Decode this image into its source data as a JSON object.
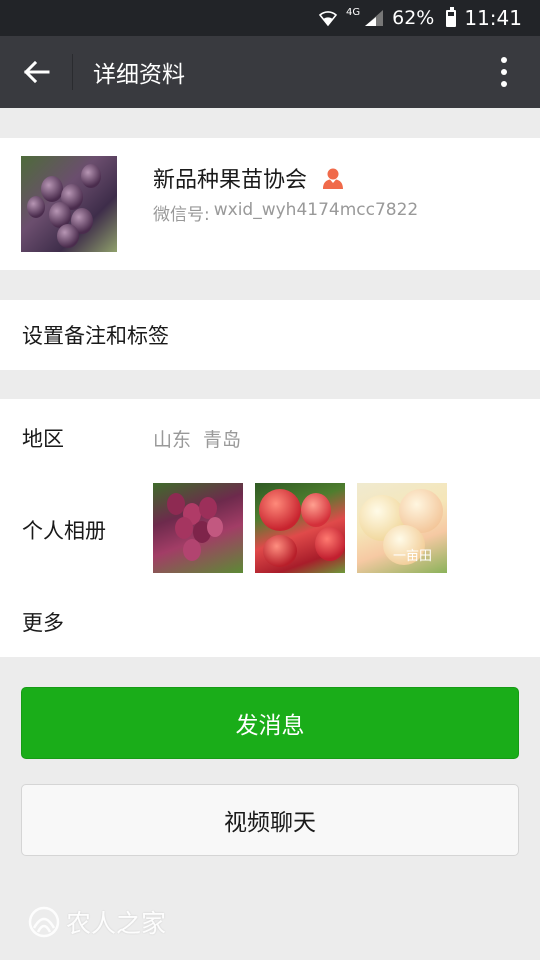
{
  "status_bar": {
    "network": "4G",
    "battery": "62%",
    "battery_level": 0.62,
    "time": "11:41"
  },
  "title_bar": {
    "title": "详细资料",
    "back_icon": "arrow-left-icon",
    "more_icon": "more-vertical-icon"
  },
  "profile": {
    "nickname": "新品种果苗协会",
    "wechat_id_label": "微信号:",
    "wechat_id": "wxid_wyh4174mcc7822",
    "badge_icon": "person-icon",
    "badge_color": "#f06a4a"
  },
  "remark": {
    "label": "设置备注和标签"
  },
  "details": {
    "region_label": "地区",
    "region_province": "山东",
    "region_city": "青岛",
    "album_label": "个人相册",
    "album_photo3_caption": "一亩田",
    "more_label": "更多"
  },
  "actions": {
    "send_message": "发消息",
    "video_call": "视频聊天",
    "primary_color": "#1aad19"
  },
  "watermark": {
    "text": "农人之家"
  }
}
